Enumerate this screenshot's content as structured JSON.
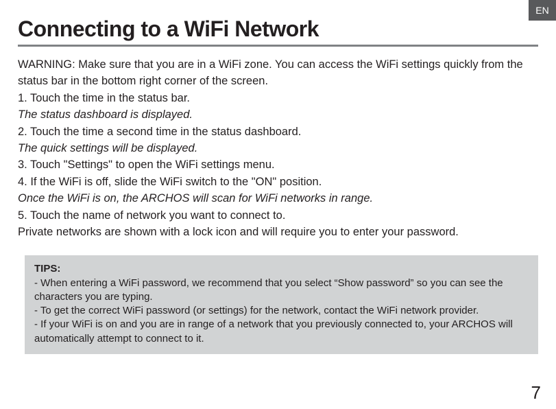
{
  "lang_tab": "EN",
  "title": "Connecting to a WiFi Network",
  "paragraphs": {
    "warning": "WARNING:  Make sure that you are in a WiFi zone. You can access the WiFi settings quickly from the status bar in the bottom right corner of the screen.",
    "step1": "1. Touch the time in the status bar.",
    "note1": "The status dashboard is displayed.",
    "step2": "2. Touch the time a second time in the status dashboard.",
    "note2": "The quick settings will be displayed.",
    "step3": "3. Touch \"Settings\" to open the WiFi settings menu.",
    "step4": "4. If the WiFi is off, slide the WiFi switch to the \"ON\" position.",
    "note3": "Once the WiFi is on, the ARCHOS will scan for WiFi networks in range.",
    "step5": "5. Touch the name of network you want to connect to.",
    "private": "Private networks are shown with a lock icon and will require you to enter your password."
  },
  "tips": {
    "title": "TIPS:",
    "items": [
      "-    When entering a WiFi password, we recommend that you select “Show password” so you can see the characters you are typing.",
      "-    To get the correct WiFi password (or settings) for the network, contact the WiFi network provider.",
      "-    If your WiFi is on and you are in range of a network that you previously connected to, your ARCHOS will automatically attempt to connect to it."
    ]
  },
  "page_number": "7"
}
